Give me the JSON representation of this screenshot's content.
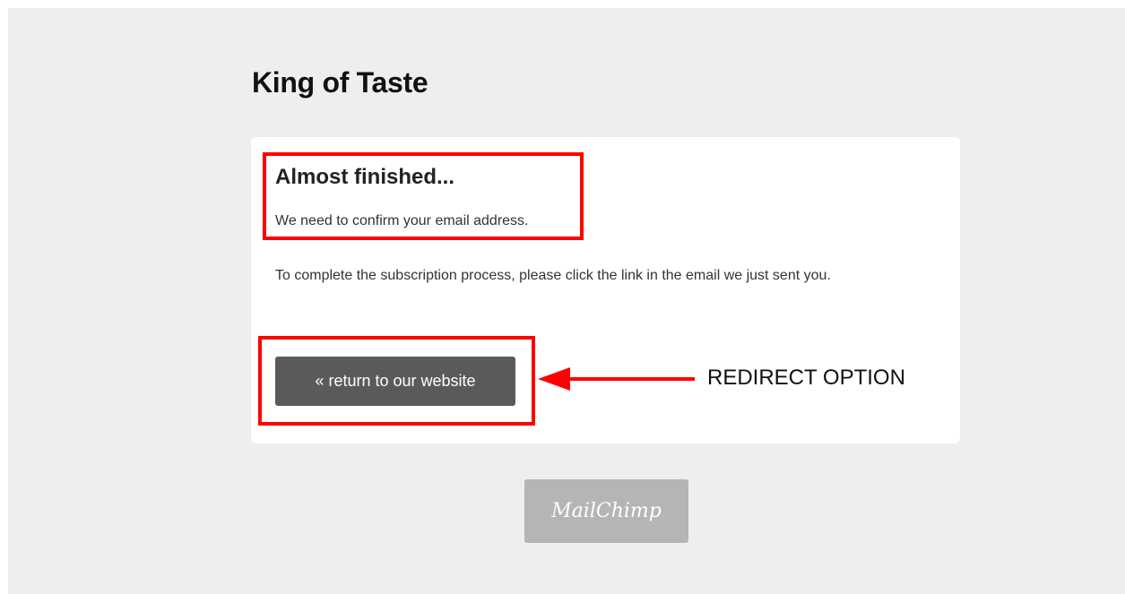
{
  "site": {
    "title": "King of Taste"
  },
  "confirmation": {
    "heading": "Almost finished...",
    "subtext": "We need to confirm your email address.",
    "instruction": "To complete the subscription process, please click the link in the email we just sent you."
  },
  "actions": {
    "return_label": "« return to our website"
  },
  "annotation": {
    "label": "REDIRECT OPTION",
    "color": "#ff0000"
  },
  "footer": {
    "badge_text": "MailChimp"
  },
  "colors": {
    "page_bg": "#eeeeee",
    "card_bg": "#ffffff",
    "button_bg": "#5a5a5a",
    "badge_bg": "#b5b5b5"
  }
}
